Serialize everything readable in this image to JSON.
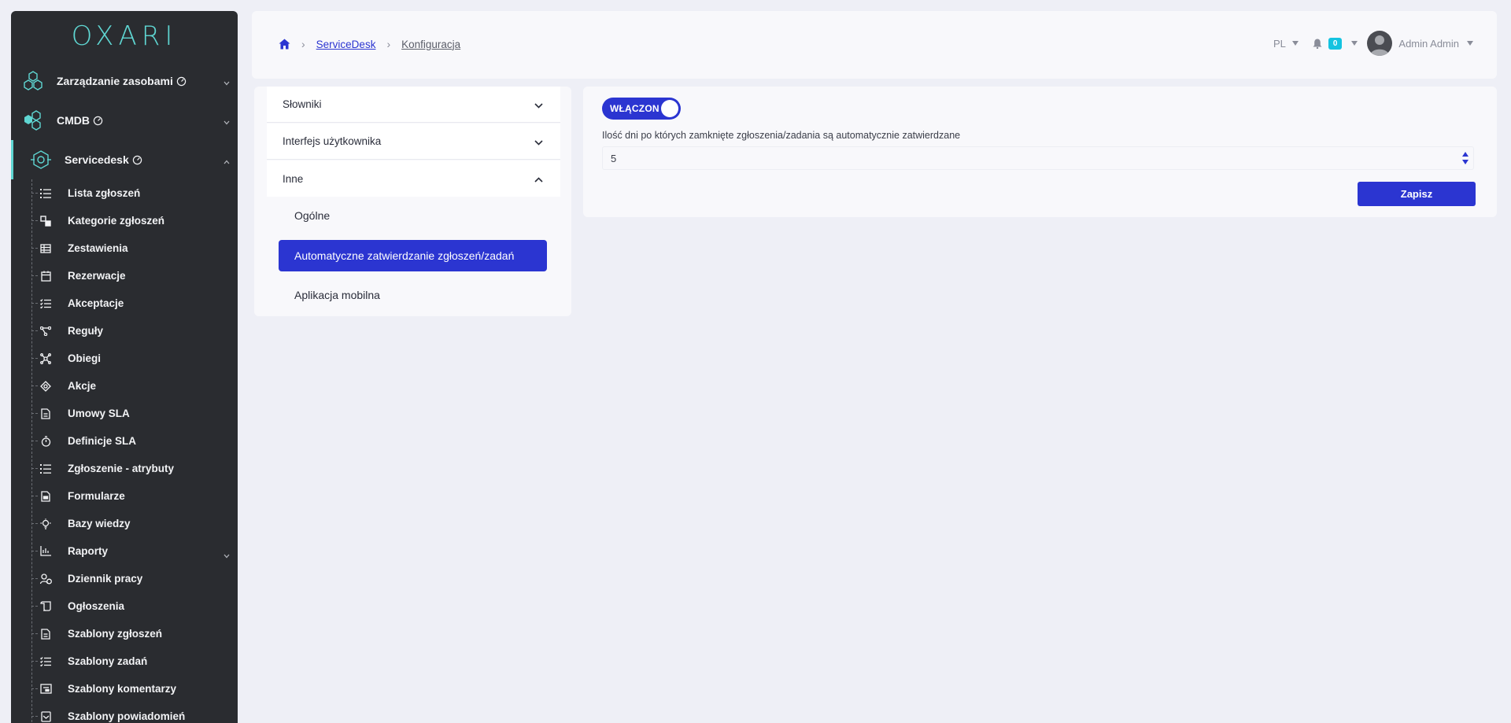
{
  "app": {
    "logo": "OXARI"
  },
  "sidebar": {
    "top_items": [
      {
        "label": "Zarządzanie zasobami",
        "icon": "hexagon-cluster-icon"
      },
      {
        "label": "CMDB",
        "icon": "cubes-icon"
      },
      {
        "label": "Servicedesk",
        "icon": "eye-target-icon"
      }
    ],
    "sub_items": [
      {
        "label": "Lista zgłoszeń",
        "icon": "list-icon"
      },
      {
        "label": "Kategorie zgłoszeń",
        "icon": "categories-icon"
      },
      {
        "label": "Zestawienia",
        "icon": "table-icon"
      },
      {
        "label": "Rezerwacje",
        "icon": "calendar-icon"
      },
      {
        "label": "Akceptacje",
        "icon": "checklist-icon"
      },
      {
        "label": "Reguły",
        "icon": "rules-icon"
      },
      {
        "label": "Obiegi",
        "icon": "workflow-icon"
      },
      {
        "label": "Akcje",
        "icon": "actions-icon"
      },
      {
        "label": "Umowy SLA",
        "icon": "document-icon"
      },
      {
        "label": "Definicje SLA",
        "icon": "stopwatch-icon"
      },
      {
        "label": "Zgłoszenie - atrybuty",
        "icon": "list-icon"
      },
      {
        "label": "Formularze",
        "icon": "form-icon"
      },
      {
        "label": "Bazy wiedzy",
        "icon": "lightbulb-icon"
      },
      {
        "label": "Raporty",
        "icon": "chart-icon"
      },
      {
        "label": "Dziennik pracy",
        "icon": "user-clock-icon"
      },
      {
        "label": "Ogłoszenia",
        "icon": "scroll-icon"
      },
      {
        "label": "Szablony zgłoszeń",
        "icon": "document-icon"
      },
      {
        "label": "Szablony zadań",
        "icon": "checklist-icon"
      },
      {
        "label": "Szablony komentarzy",
        "icon": "comment-template-icon"
      },
      {
        "label": "Szablony powiadomień",
        "icon": "notification-template-icon"
      }
    ]
  },
  "breadcrumb": {
    "home": "home-icon",
    "items": [
      "ServiceDesk",
      "Konfiguracja"
    ]
  },
  "header": {
    "language": "PL",
    "notifications_count": "0",
    "user_name": "Admin Admin"
  },
  "config_menu": {
    "sections": [
      "Słowniki",
      "Interfejs użytkownika",
      "Inne"
    ],
    "subsections": [
      "Ogólne",
      "Automatyczne zatwierdzanie zgłoszeń/zadań",
      "Aplikacja mobilna"
    ]
  },
  "settings": {
    "toggle_label": "WŁĄCZON",
    "toggle_on": true,
    "field_label": "Ilość dni po których zamknięte zgłoszenia/zadania są automatycznie zatwierdzane",
    "field_value": "5",
    "save_label": "Zapisz"
  },
  "colors": {
    "accent": "#2b35d1",
    "sidebar_bg": "#2a2c30",
    "brand": "#5fd6d2",
    "badge": "#14c3e0"
  }
}
